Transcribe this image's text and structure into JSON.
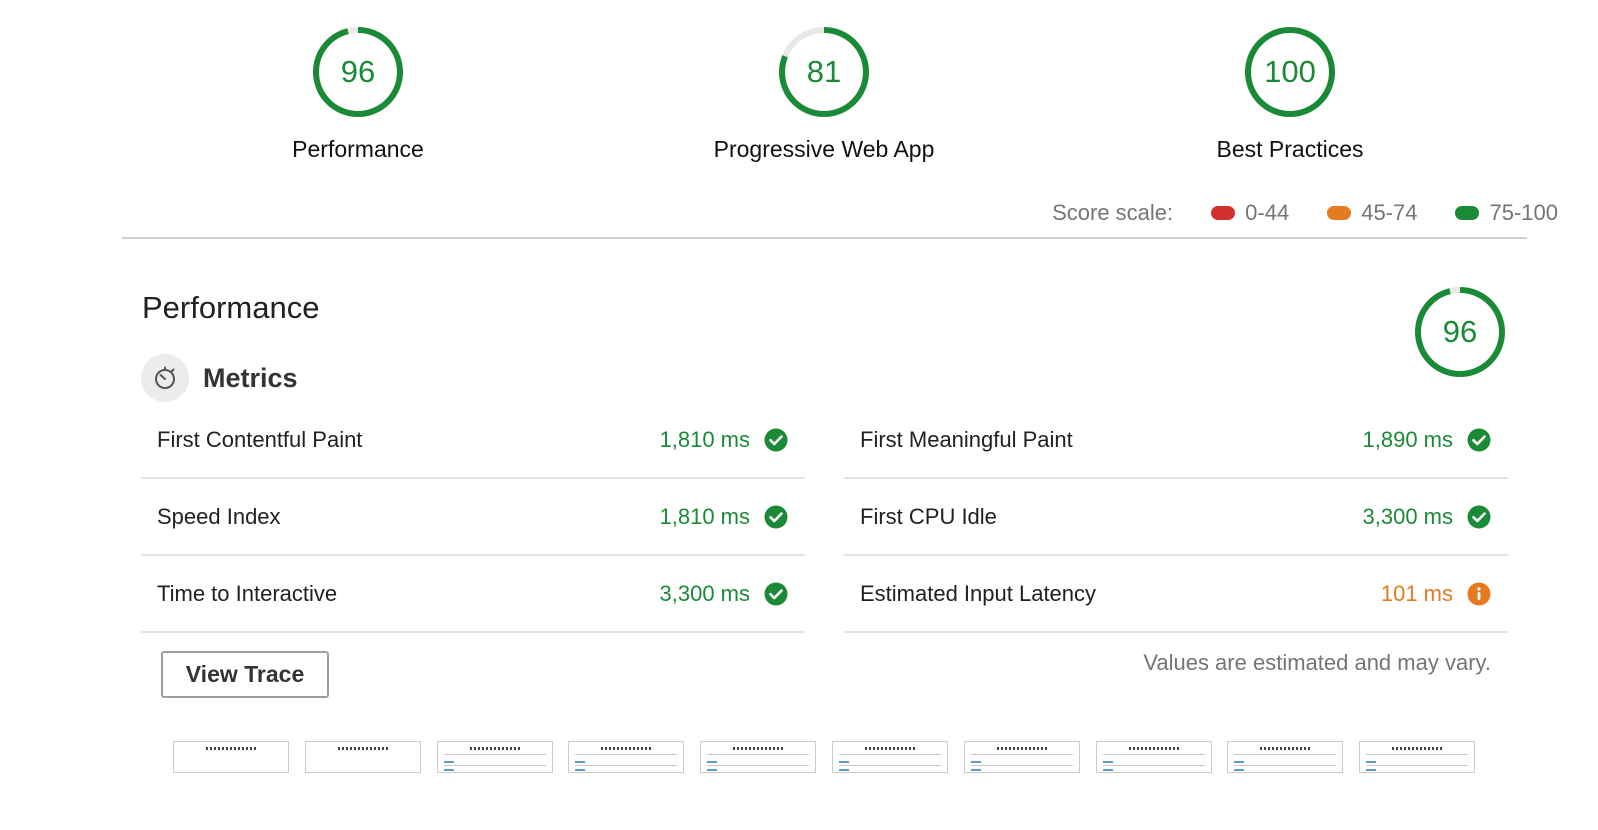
{
  "gauges": [
    {
      "score": "96",
      "label": "Performance",
      "fraction": 0.96
    },
    {
      "score": "81",
      "label": "Progressive Web App",
      "fraction": 0.81
    },
    {
      "score": "100",
      "label": "Best Practices",
      "fraction": 1.0
    }
  ],
  "score_scale": {
    "label": "Score scale:",
    "ranges": [
      {
        "text": "0-44",
        "color": "#d32f2f"
      },
      {
        "text": "45-74",
        "color": "#e67a1e"
      },
      {
        "text": "75-100",
        "color": "#1b8a37"
      }
    ]
  },
  "performance": {
    "title": "Performance",
    "score": "96",
    "fraction": 0.96,
    "metrics_title": "Metrics",
    "metrics_left": [
      {
        "name": "First Contentful Paint",
        "value": "1,810 ms",
        "status": "pass"
      },
      {
        "name": "Speed Index",
        "value": "1,810 ms",
        "status": "pass"
      },
      {
        "name": "Time to Interactive",
        "value": "3,300 ms",
        "status": "pass"
      }
    ],
    "metrics_right": [
      {
        "name": "First Meaningful Paint",
        "value": "1,890 ms",
        "status": "pass"
      },
      {
        "name": "First CPU Idle",
        "value": "3,300 ms",
        "status": "pass"
      },
      {
        "name": "Estimated Input Latency",
        "value": "101 ms",
        "status": "average"
      }
    ],
    "view_trace_label": "View Trace",
    "note": "Values are estimated and may vary."
  },
  "colors": {
    "pass": "#1b8a37",
    "average": "#e67a1e",
    "fail": "#d32f2f",
    "ring_track": "#e8e8e8"
  },
  "icons": {
    "pass": "check-circle-icon",
    "average": "info-circle-icon",
    "metrics": "stopwatch-icon"
  }
}
